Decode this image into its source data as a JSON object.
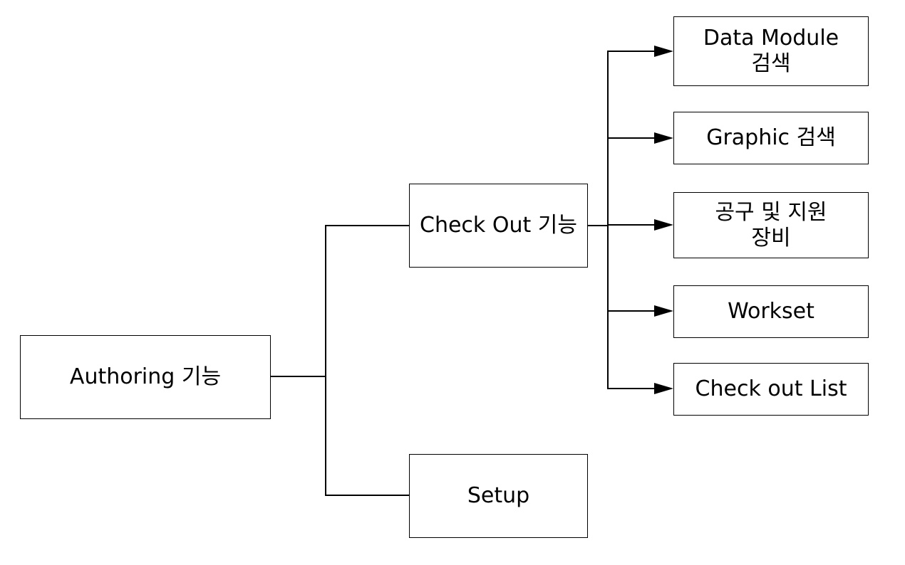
{
  "root": {
    "label": "Authoring 기능"
  },
  "branches": [
    {
      "label": "Check Out 기능"
    },
    {
      "label": "Setup"
    }
  ],
  "checkout_children": [
    {
      "label": "Data Module\n검색"
    },
    {
      "label": "Graphic 검색"
    },
    {
      "label": "공구 및 지원\n장비"
    },
    {
      "label": "Workset"
    },
    {
      "label": "Check out List"
    }
  ]
}
